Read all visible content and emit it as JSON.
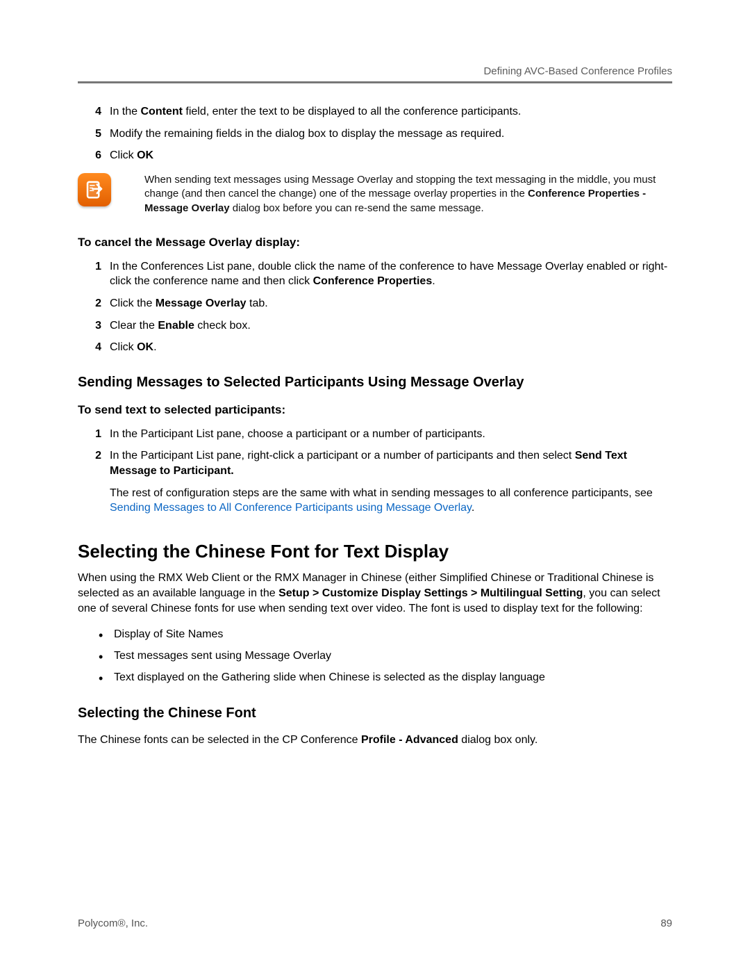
{
  "header": {
    "section_title": "Defining AVC-Based Conference Profiles"
  },
  "steps_top": {
    "items": [
      {
        "num": "4",
        "html": "In the <b>Content</b> field, enter the text to be displayed to all the conference participants."
      },
      {
        "num": "5",
        "html": "Modify the remaining fields in the dialog box to display the message as required."
      },
      {
        "num": "6",
        "html": "Click <b>OK</b>"
      }
    ]
  },
  "note": {
    "text_html": "When sending text messages using Message Overlay and stopping the text messaging in the middle, you must change (and then cancel the change) one of the message overlay properties in the <b>Conference Properties - Message Overlay</b> dialog box before you can re-send the same message."
  },
  "cancel_overlay": {
    "title": "To cancel the Message Overlay display:",
    "items": [
      {
        "num": "1",
        "html": "In the Conferences List pane, double click the name of the conference to have Message Overlay enabled or right-click the conference name and then click <b>Conference Properties</b>."
      },
      {
        "num": "2",
        "html": "Click the <b>Message Overlay</b> tab."
      },
      {
        "num": "3",
        "html": "Clear the <b>Enable</b> check box."
      },
      {
        "num": "4",
        "html": "Click <b>OK</b>."
      }
    ]
  },
  "selected_participants": {
    "heading": "Sending Messages to Selected Participants Using Message Overlay",
    "subhead": "To send text to selected participants:",
    "items": [
      {
        "num": "1",
        "html": "In the Participant List pane, choose a participant or a number of participants."
      },
      {
        "num": "2",
        "html": "In the Participant List pane, right-click a participant or a number of participants and then select <b>Send Text Message to Participant.</b>"
      }
    ],
    "after_pre": "The rest of configuration steps are the same with what in sending messages to all conference participants, see ",
    "link_text": "Sending Messages to All Conference Participants using Message Overlay",
    "after_post": "."
  },
  "chinese_font": {
    "h1": "Selecting the Chinese Font for Text Display",
    "intro_html": "When using the RMX Web Client or the RMX Manager in Chinese (either Simplified Chinese or Traditional Chinese is selected as an available language in the <b>Setup > Customize Display Settings > Multilingual Setting</b>, you can select one of several Chinese fonts for use when sending text over video. The font is used to display text for the following:",
    "bullets": [
      "Display of Site Names",
      "Test messages sent using Message Overlay",
      "Text displayed on the Gathering slide when Chinese is selected as the display language"
    ],
    "h2": "Selecting the Chinese Font",
    "para_html": "The Chinese fonts can be selected in the CP Conference <b>Profile - Advanced</b> dialog box only."
  },
  "footer": {
    "left": "Polycom®, Inc.",
    "right": "89"
  }
}
